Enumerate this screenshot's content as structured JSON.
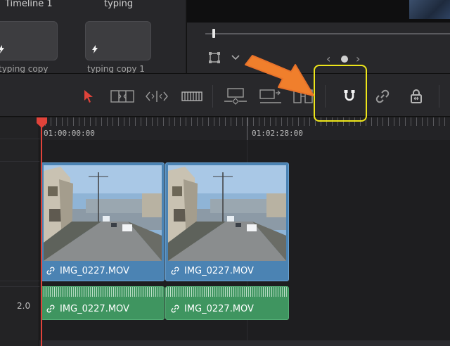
{
  "media_pool": {
    "items": [
      {
        "title": "Timeline 1",
        "caption": "typing copy"
      },
      {
        "title": "typing",
        "caption": "typing copy 1"
      }
    ]
  },
  "toolbar": {
    "tools": [
      {
        "name": "selection-mode",
        "icon": "arrow-pointer-icon",
        "active": true
      },
      {
        "name": "trim-edit-mode",
        "icon": "trim-icon"
      },
      {
        "name": "dynamic-trim-mode",
        "icon": "dynamic-trim-icon"
      },
      {
        "name": "blade-edit-mode",
        "icon": "blade-icon"
      },
      {
        "name": "insert-clip",
        "icon": "insert-clip-icon"
      },
      {
        "name": "overwrite-clip",
        "icon": "overwrite-clip-icon"
      },
      {
        "name": "replace-clip",
        "icon": "replace-clip-icon"
      },
      {
        "name": "snapping",
        "icon": "magnet-icon"
      },
      {
        "name": "linked-selection",
        "icon": "link-icon"
      },
      {
        "name": "position-lock",
        "icon": "lock-icon"
      }
    ],
    "highlight_color": "#eee61a",
    "annotation_color": "#f07f2c"
  },
  "timeline": {
    "ruler": {
      "timecodes": [
        "01:00:00:00",
        "01:02:28:00"
      ]
    },
    "audio_track_level": "2.0",
    "video_clips": [
      {
        "name": "IMG_0227.MOV"
      },
      {
        "name": "IMG_0227.MOV"
      }
    ],
    "audio_clips": [
      {
        "name": "IMG_0227.MOV"
      },
      {
        "name": "IMG_0227.MOV"
      }
    ],
    "colors": {
      "video": "#4b83b3",
      "audio": "#3f9560",
      "playhead": "#e0433a"
    }
  }
}
